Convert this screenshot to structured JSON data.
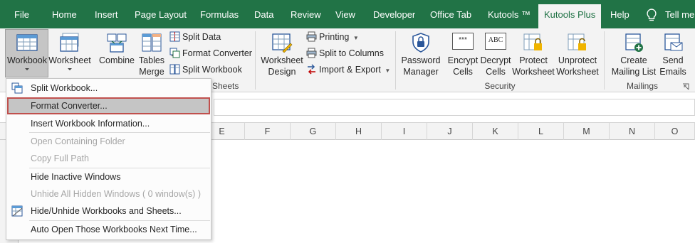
{
  "tabs": [
    {
      "label": "File"
    },
    {
      "label": "Home"
    },
    {
      "label": "Insert"
    },
    {
      "label": "Page Layout"
    },
    {
      "label": "Formulas"
    },
    {
      "label": "Data"
    },
    {
      "label": "Review"
    },
    {
      "label": "View"
    },
    {
      "label": "Developer"
    },
    {
      "label": "Office Tab"
    },
    {
      "label": "Kutools ™"
    },
    {
      "label": "Kutools Plus"
    },
    {
      "label": "Help"
    }
  ],
  "tell_me": "Tell me",
  "ribbon": {
    "workbook": {
      "line1": "Workbook"
    },
    "worksheet": {
      "line1": "Worksheet"
    },
    "combine": {
      "line1": "Combine"
    },
    "tables_merge": {
      "line1": "Tables",
      "line2": "Merge"
    },
    "split_data": "Split Data",
    "format_converter": "Format Converter",
    "split_workbook": "Split Workbook",
    "group_sheets_label": "Sheets",
    "worksheet_design": {
      "line1": "Worksheet",
      "line2": "Design"
    },
    "printing": "Printing",
    "split_to_columns": "Split to Columns",
    "import_export": "Import & Export",
    "password_manager": {
      "line1": "Password",
      "line2": "Manager"
    },
    "encrypt_cells": {
      "line1": "Encrypt",
      "line2": "Cells"
    },
    "decrypt_cells": {
      "line1": "Decrypt",
      "line2": "Cells"
    },
    "protect_worksheet": {
      "line1": "Protect",
      "line2": "Worksheet"
    },
    "unprotect_worksheet": {
      "line1": "Unprotect",
      "line2": "Worksheet"
    },
    "group_security_label": "Security",
    "create_mailing_list": {
      "line1": "Create",
      "line2": "Mailing List"
    },
    "send_emails": {
      "line1": "Send",
      "line2": "Emails"
    },
    "group_mailings_label": "Mailings",
    "encrypt_icon_text": "***",
    "decrypt_icon_text": "ABC"
  },
  "columns": [
    "E",
    "F",
    "G",
    "H",
    "I",
    "J",
    "K",
    "L",
    "M",
    "N",
    "O"
  ],
  "menu": {
    "items": [
      {
        "label": "Split Workbook...",
        "disabled": false
      },
      {
        "label": "Format Converter...",
        "disabled": false
      },
      {
        "label": "Insert Workbook Information...",
        "disabled": false
      },
      {
        "label": "Open Containing Folder",
        "disabled": true
      },
      {
        "label": "Copy Full Path",
        "disabled": true
      },
      {
        "label": "Hide Inactive Windows",
        "disabled": false
      },
      {
        "label": "Unhide All Hidden Windows ( 0 window(s) )",
        "disabled": true
      },
      {
        "label": "Hide/Unhide Workbooks and Sheets...",
        "disabled": false
      },
      {
        "label": "Auto Open Those Workbooks Next Time...",
        "disabled": false
      }
    ]
  },
  "colors": {
    "accent": "#217346",
    "highlight_border": "#c0504d",
    "ribbon_bg": "#f3f3f3"
  }
}
